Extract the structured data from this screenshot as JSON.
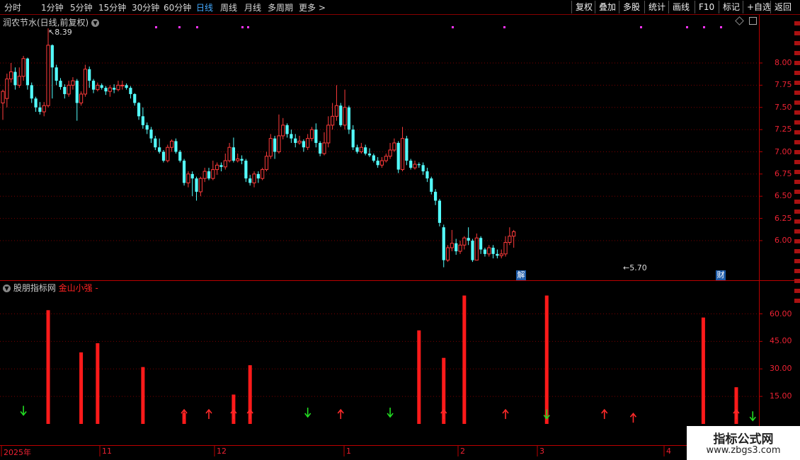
{
  "toolbar": {
    "left_items": [
      "分时",
      "1分钟",
      "5分钟",
      "15分钟",
      "30分钟",
      "60分钟",
      "日线",
      "周线",
      "月线",
      "多周期",
      "更多"
    ],
    "active": "日线",
    "more_arrow": ">",
    "right_items": [
      "复权",
      "叠加",
      "多股",
      "统计",
      "画线",
      "F10",
      "标记",
      "+自选",
      "返回"
    ]
  },
  "main_panel": {
    "title": "润农节水(日线,前复权)",
    "high_label": "8.39",
    "low_label": "5.70",
    "y_ticks": [
      "8.00",
      "7.75",
      "7.50",
      "7.25",
      "7.00",
      "6.75",
      "6.50",
      "6.25",
      "6.00"
    ],
    "badge_jie": "解",
    "badge_cai": "财"
  },
  "sub_panel": {
    "title": "股朋指标网",
    "indicator_name": "金山小强",
    "indicator_suffix": "-",
    "y_ticks": [
      "60.00",
      "45.00",
      "30.00",
      "15.00"
    ]
  },
  "x_axis": {
    "labels": [
      "2025年",
      "11",
      "12",
      "1",
      "2",
      "3",
      "4"
    ]
  },
  "watermark": {
    "title": "指标公式网",
    "url": "www.zbgs3.com"
  },
  "colors": {
    "up": "#ff3b3b",
    "down": "#54ffff",
    "grid": "#8b0000",
    "bar": "#ff1a1a",
    "arrow_up": "#ff2a2a",
    "arrow_down": "#22dd22"
  },
  "chart_data": [
    {
      "type": "candlestick",
      "title": "润农节水(日线,前复权)",
      "ylim": [
        5.65,
        8.45
      ],
      "y_ticks": [
        8.0,
        7.75,
        7.5,
        7.25,
        7.0,
        6.75,
        6.5,
        6.25,
        6.0
      ],
      "annotations": [
        {
          "text": "8.39",
          "value": 8.39
        },
        {
          "text": "5.70",
          "value": 5.7
        }
      ],
      "candles": [
        [
          7.55,
          7.68,
          7.7,
          7.36
        ],
        [
          7.6,
          7.82,
          7.88,
          7.5
        ],
        [
          7.82,
          7.9,
          8.0,
          7.78
        ],
        [
          7.9,
          7.75,
          7.95,
          7.7
        ],
        [
          7.75,
          7.85,
          7.95,
          7.72
        ],
        [
          7.85,
          8.05,
          8.08,
          7.8
        ],
        [
          8.05,
          7.75,
          8.06,
          7.7
        ],
        [
          7.75,
          7.6,
          7.78,
          7.55
        ],
        [
          7.6,
          7.5,
          7.62,
          7.45
        ],
        [
          7.5,
          7.45,
          7.56,
          7.42
        ],
        [
          7.45,
          7.52,
          7.56,
          7.4
        ],
        [
          7.52,
          8.2,
          8.39,
          7.5
        ],
        [
          8.2,
          7.95,
          8.21,
          7.6
        ],
        [
          7.95,
          7.8,
          7.98,
          7.75
        ],
        [
          7.8,
          7.73,
          7.83,
          7.7
        ],
        [
          7.73,
          7.65,
          7.76,
          7.6
        ],
        [
          7.65,
          7.75,
          7.8,
          7.62
        ],
        [
          7.75,
          7.8,
          7.84,
          7.7
        ],
        [
          7.8,
          7.55,
          7.82,
          7.35
        ],
        [
          7.55,
          7.65,
          7.68,
          7.52
        ],
        [
          7.65,
          7.93,
          7.98,
          7.62
        ],
        [
          7.93,
          7.8,
          7.96,
          7.72
        ],
        [
          7.8,
          7.7,
          7.82,
          7.66
        ],
        [
          7.7,
          7.75,
          7.78,
          7.68
        ],
        [
          7.75,
          7.72,
          7.77,
          7.7
        ],
        [
          7.72,
          7.68,
          7.74,
          7.64
        ],
        [
          7.68,
          7.72,
          7.75,
          7.62
        ],
        [
          7.72,
          7.7,
          7.76,
          7.66
        ],
        [
          7.7,
          7.75,
          7.8,
          7.68
        ],
        [
          7.75,
          7.75,
          7.8,
          7.7
        ],
        [
          7.75,
          7.72,
          7.77,
          7.7
        ],
        [
          7.72,
          7.65,
          7.74,
          7.6
        ],
        [
          7.65,
          7.55,
          7.66,
          7.52
        ],
        [
          7.55,
          7.4,
          7.56,
          7.36
        ],
        [
          7.4,
          7.3,
          7.5,
          7.26
        ],
        [
          7.3,
          7.25,
          7.33,
          7.2
        ],
        [
          7.25,
          7.15,
          7.28,
          7.1
        ],
        [
          7.15,
          7.05,
          7.18,
          7.02
        ],
        [
          7.05,
          7.0,
          7.15,
          6.98
        ],
        [
          7.0,
          6.9,
          7.02,
          6.88
        ],
        [
          6.9,
          7.05,
          7.08,
          6.88
        ],
        [
          7.05,
          7.12,
          7.14,
          7.0
        ],
        [
          7.12,
          7.0,
          7.15,
          6.98
        ],
        [
          7.0,
          6.9,
          7.02,
          6.88
        ],
        [
          6.9,
          6.65,
          6.92,
          6.62
        ],
        [
          6.65,
          6.75,
          6.78,
          6.6
        ],
        [
          6.75,
          6.7,
          6.78,
          6.5
        ],
        [
          6.7,
          6.55,
          6.72,
          6.45
        ],
        [
          6.55,
          6.7,
          6.72,
          6.5
        ],
        [
          6.7,
          6.78,
          6.82,
          6.66
        ],
        [
          6.78,
          6.7,
          6.82,
          6.68
        ],
        [
          6.7,
          6.8,
          6.9,
          6.68
        ],
        [
          6.8,
          6.85,
          6.88,
          6.74
        ],
        [
          6.85,
          6.83,
          6.88,
          6.78
        ],
        [
          6.83,
          6.9,
          6.98,
          6.8
        ],
        [
          6.9,
          7.05,
          7.1,
          6.88
        ],
        [
          7.05,
          6.9,
          7.16,
          6.88
        ],
        [
          6.9,
          6.92,
          6.98,
          6.88
        ],
        [
          6.92,
          6.9,
          6.96,
          6.86
        ],
        [
          6.9,
          6.7,
          6.92,
          6.66
        ],
        [
          6.7,
          6.65,
          6.74,
          6.62
        ],
        [
          6.65,
          6.75,
          6.78,
          6.6
        ],
        [
          6.75,
          6.7,
          6.78,
          6.65
        ],
        [
          6.7,
          6.8,
          6.82,
          6.68
        ],
        [
          6.8,
          6.95,
          7.0,
          6.78
        ],
        [
          6.95,
          7.15,
          7.2,
          6.92
        ],
        [
          7.15,
          7.0,
          7.18,
          6.92
        ],
        [
          7.0,
          7.18,
          7.42,
          6.98
        ],
        [
          7.18,
          7.3,
          7.38,
          7.14
        ],
        [
          7.3,
          7.2,
          7.32,
          7.16
        ],
        [
          7.2,
          7.15,
          7.25,
          7.1
        ],
        [
          7.15,
          7.1,
          7.2,
          7.05
        ],
        [
          7.1,
          7.12,
          7.18,
          7.08
        ],
        [
          7.12,
          7.05,
          7.14,
          7.0
        ],
        [
          7.05,
          7.15,
          7.2,
          7.02
        ],
        [
          7.15,
          7.25,
          7.28,
          7.12
        ],
        [
          7.25,
          7.1,
          7.32,
          7.05
        ],
        [
          7.1,
          6.98,
          7.12,
          6.95
        ],
        [
          6.98,
          7.1,
          7.22,
          6.96
        ],
        [
          7.1,
          7.3,
          7.4,
          7.05
        ],
        [
          7.3,
          7.4,
          7.55,
          7.25
        ],
        [
          7.4,
          7.52,
          7.75,
          7.35
        ],
        [
          7.52,
          7.3,
          7.55,
          7.28
        ],
        [
          7.3,
          7.5,
          7.7,
          7.25
        ],
        [
          7.5,
          7.25,
          7.52,
          7.2
        ],
        [
          7.25,
          7.05,
          7.3,
          7.02
        ],
        [
          7.05,
          7.0,
          7.08,
          6.98
        ],
        [
          7.0,
          7.05,
          7.1,
          6.98
        ],
        [
          7.05,
          6.98,
          7.08,
          6.96
        ],
        [
          6.98,
          6.96,
          7.04,
          6.94
        ],
        [
          6.96,
          6.9,
          6.98,
          6.88
        ],
        [
          6.9,
          6.85,
          6.94,
          6.82
        ],
        [
          6.85,
          6.9,
          6.94,
          6.82
        ],
        [
          6.9,
          6.95,
          6.98,
          6.88
        ],
        [
          6.95,
          7.02,
          7.1,
          6.92
        ],
        [
          7.02,
          7.1,
          7.15,
          7.0
        ],
        [
          7.1,
          6.8,
          7.12,
          6.76
        ],
        [
          6.8,
          7.15,
          7.28,
          6.78
        ],
        [
          7.15,
          6.9,
          7.18,
          6.85
        ],
        [
          6.9,
          6.82,
          6.92,
          6.8
        ],
        [
          6.82,
          6.86,
          6.9,
          6.8
        ],
        [
          6.86,
          6.85,
          6.88,
          6.82
        ],
        [
          6.85,
          6.78,
          6.88,
          6.74
        ],
        [
          6.78,
          6.7,
          6.82,
          6.66
        ],
        [
          6.7,
          6.55,
          6.72,
          6.52
        ],
        [
          6.55,
          6.45,
          6.58,
          6.4
        ],
        [
          6.45,
          6.2,
          6.47,
          6.16
        ],
        [
          6.15,
          5.78,
          6.18,
          5.7
        ],
        [
          5.78,
          5.92,
          5.95,
          5.76
        ],
        [
          5.92,
          5.97,
          6.12,
          5.88
        ],
        [
          5.97,
          5.88,
          6.02,
          5.84
        ],
        [
          5.88,
          5.95,
          6.0,
          5.85
        ],
        [
          5.95,
          6.03,
          6.05,
          5.9
        ],
        [
          6.03,
          6.0,
          6.15,
          5.95
        ],
        [
          6.0,
          5.78,
          6.02,
          5.76
        ],
        [
          5.78,
          6.03,
          6.08,
          5.78
        ],
        [
          6.03,
          5.9,
          6.05,
          5.85
        ],
        [
          5.9,
          5.85,
          5.92,
          5.82
        ],
        [
          5.85,
          5.92,
          5.95,
          5.82
        ],
        [
          5.92,
          5.85,
          5.95,
          5.8
        ],
        [
          5.85,
          5.83,
          5.9,
          5.8
        ],
        [
          5.83,
          5.85,
          5.9,
          5.8
        ],
        [
          5.85,
          5.98,
          6.05,
          5.82
        ],
        [
          5.98,
          6.05,
          6.15,
          5.95
        ],
        [
          6.05,
          6.1,
          6.12,
          5.92
        ]
      ]
    },
    {
      "type": "bar",
      "title": "金山小强",
      "ylim": [
        0,
        70
      ],
      "y_ticks": [
        60,
        45,
        30,
        15
      ],
      "bars": [
        {
          "i": 11,
          "value": 62
        },
        {
          "i": 19,
          "value": 39
        },
        {
          "i": 23,
          "value": 44
        },
        {
          "i": 34,
          "value": 31
        },
        {
          "i": 44,
          "value": 6
        },
        {
          "i": 56,
          "value": 16
        },
        {
          "i": 60,
          "value": 32
        },
        {
          "i": 101,
          "value": 51
        },
        {
          "i": 107,
          "value": 36
        },
        {
          "i": 112,
          "value": 70
        },
        {
          "i": 132,
          "value": 70
        },
        {
          "i": 170,
          "value": 58
        },
        {
          "i": 178,
          "value": 20
        }
      ],
      "arrows_up": [
        {
          "i": 44,
          "value": 5
        },
        {
          "i": 50,
          "value": 5
        },
        {
          "i": 56,
          "value": 5
        },
        {
          "i": 60,
          "value": 5
        },
        {
          "i": 82,
          "value": 5
        },
        {
          "i": 107,
          "value": 5
        },
        {
          "i": 122,
          "value": 5
        },
        {
          "i": 146,
          "value": 5
        },
        {
          "i": 153,
          "value": 3
        },
        {
          "i": 178,
          "value": 5
        }
      ],
      "arrows_down": [
        {
          "i": 5,
          "value": 6
        },
        {
          "i": 74,
          "value": 5
        },
        {
          "i": 94,
          "value": 5
        },
        {
          "i": 132,
          "value": 4
        },
        {
          "i": 182,
          "value": 3
        }
      ]
    }
  ]
}
